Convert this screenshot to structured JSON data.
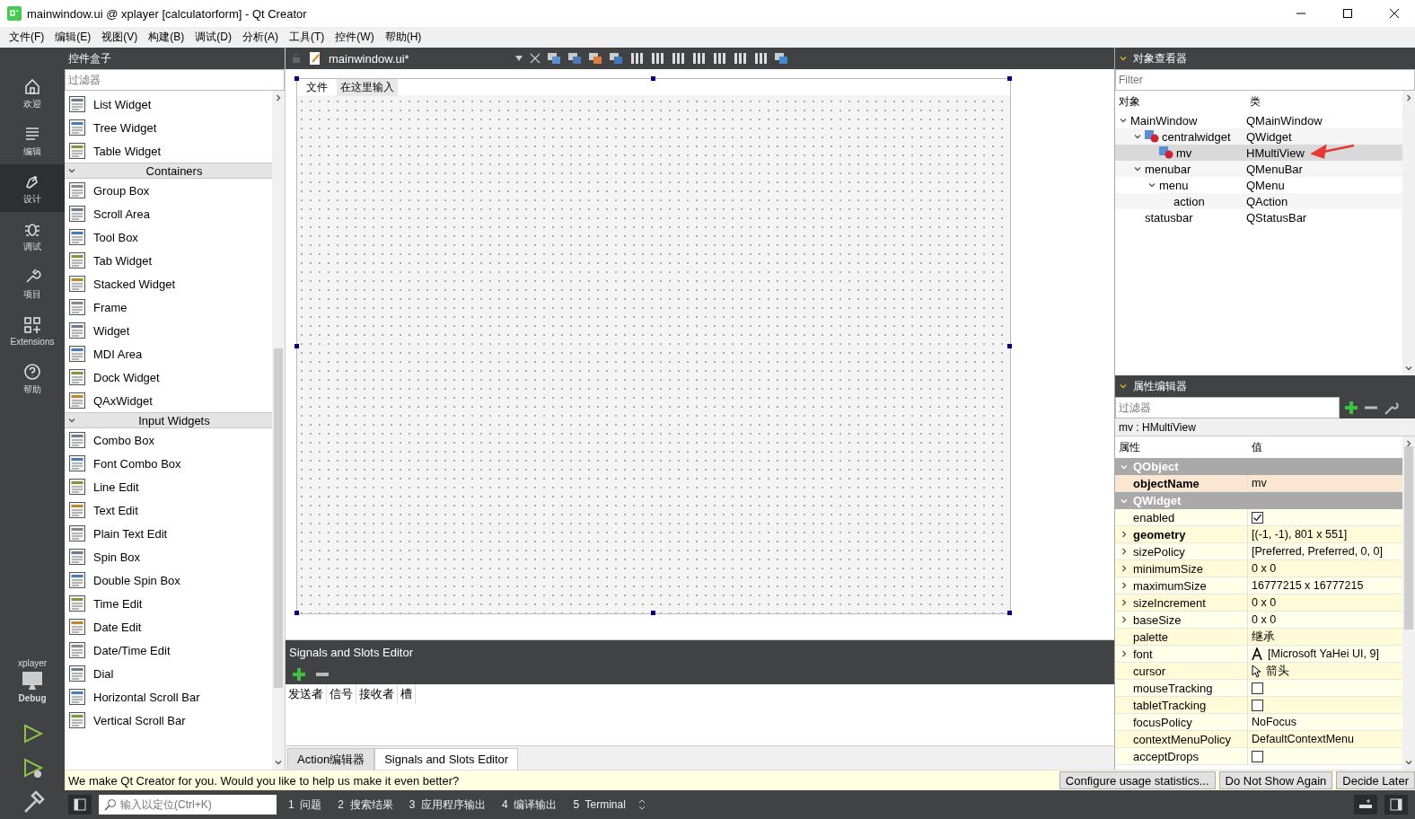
{
  "window": {
    "title": "mainwindow.ui @ xplayer [calculatorform] - Qt Creator"
  },
  "menu": [
    "文件(F)",
    "编辑(E)",
    "视图(V)",
    "构建(B)",
    "调试(D)",
    "分析(A)",
    "工具(T)",
    "控件(W)",
    "帮助(H)"
  ],
  "modes": [
    {
      "label": "欢迎",
      "selected": false
    },
    {
      "label": "编辑",
      "selected": false
    },
    {
      "label": "设计",
      "selected": true
    },
    {
      "label": "调试",
      "selected": false
    },
    {
      "label": "项目",
      "selected": false
    },
    {
      "label": "Extensions",
      "selected": false
    },
    {
      "label": "帮助",
      "selected": false
    }
  ],
  "target": {
    "project": "xplayer",
    "config": "Debug"
  },
  "toolbox": {
    "title": "控件盒子",
    "filter_placeholder": "过滤器",
    "items": [
      {
        "kind": "widget",
        "label": "List Widget"
      },
      {
        "kind": "widget",
        "label": "Tree Widget"
      },
      {
        "kind": "widget",
        "label": "Table Widget"
      },
      {
        "kind": "category",
        "label": "Containers",
        "expanded": true
      },
      {
        "kind": "widget",
        "label": "Group Box"
      },
      {
        "kind": "widget",
        "label": "Scroll Area"
      },
      {
        "kind": "widget",
        "label": "Tool Box"
      },
      {
        "kind": "widget",
        "label": "Tab Widget"
      },
      {
        "kind": "widget",
        "label": "Stacked Widget"
      },
      {
        "kind": "widget",
        "label": "Frame"
      },
      {
        "kind": "widget",
        "label": "Widget"
      },
      {
        "kind": "widget",
        "label": "MDI Area"
      },
      {
        "kind": "widget",
        "label": "Dock Widget"
      },
      {
        "kind": "widget",
        "label": "QAxWidget"
      },
      {
        "kind": "category",
        "label": "Input Widgets",
        "expanded": true
      },
      {
        "kind": "widget",
        "label": "Combo Box"
      },
      {
        "kind": "widget",
        "label": "Font Combo Box"
      },
      {
        "kind": "widget",
        "label": "Line Edit"
      },
      {
        "kind": "widget",
        "label": "Text Edit"
      },
      {
        "kind": "widget",
        "label": "Plain Text Edit"
      },
      {
        "kind": "widget",
        "label": "Spin Box"
      },
      {
        "kind": "widget",
        "label": "Double Spin Box"
      },
      {
        "kind": "widget",
        "label": "Time Edit"
      },
      {
        "kind": "widget",
        "label": "Date Edit"
      },
      {
        "kind": "widget",
        "label": "Date/Time Edit"
      },
      {
        "kind": "widget",
        "label": "Dial"
      },
      {
        "kind": "widget",
        "label": "Horizontal Scroll Bar"
      },
      {
        "kind": "widget",
        "label": "Vertical Scroll Bar"
      }
    ]
  },
  "editor": {
    "file": "mainwindow.ui*",
    "form_menu": [
      {
        "label": "文件",
        "kind": "menu"
      },
      {
        "label": "在这里输入",
        "kind": "placeholder"
      }
    ]
  },
  "signals_slots": {
    "title": "Signals and Slots Editor",
    "columns": [
      "发送者",
      "信号",
      "接收者",
      "槽"
    ]
  },
  "bottom_tabs": [
    {
      "label": "Action编辑器",
      "selected": false
    },
    {
      "label": "Signals and Slots Editor",
      "selected": true
    }
  ],
  "object_inspector": {
    "title": "对象查看器",
    "filter_placeholder": "Filter",
    "columns": [
      "对象",
      "类"
    ],
    "tree": [
      {
        "name": "MainWindow",
        "class": "QMainWindow",
        "expanded": true,
        "selected": false,
        "children": [
          {
            "name": "centralwidget",
            "class": "QWidget",
            "icon": true,
            "expanded": true,
            "selected": false,
            "children": [
              {
                "name": "mv",
                "class": "HMultiView",
                "icon": true,
                "selected": true
              }
            ]
          },
          {
            "name": "menubar",
            "class": "QMenuBar",
            "expanded": true,
            "selected": false,
            "children": [
              {
                "name": "menu",
                "class": "QMenu",
                "expanded": true,
                "selected": false,
                "children": [
                  {
                    "name": "action",
                    "class": "QAction",
                    "selected": false
                  }
                ]
              }
            ]
          },
          {
            "name": "statusbar",
            "class": "QStatusBar",
            "selected": false
          }
        ]
      }
    ]
  },
  "property_editor": {
    "title": "属性编辑器",
    "filter_placeholder": "过滤器",
    "object": "mv : HMultiView",
    "columns": [
      "属性",
      "值"
    ],
    "groups": [
      {
        "name": "QObject",
        "expanded": true,
        "properties": [
          {
            "name": "objectName",
            "kind": "text",
            "value": "mv",
            "bold": true,
            "expandable": false
          }
        ]
      },
      {
        "name": "QWidget",
        "expanded": true,
        "properties": [
          {
            "name": "enabled",
            "kind": "checkbox",
            "checked": true,
            "bold": false,
            "expandable": false
          },
          {
            "name": "geometry",
            "kind": "text",
            "value": "[(-1, -1), 801 x 551]",
            "bold": true,
            "expandable": true
          },
          {
            "name": "sizePolicy",
            "kind": "text",
            "value": "[Preferred, Preferred, 0, 0]",
            "bold": false,
            "expandable": true
          },
          {
            "name": "minimumSize",
            "kind": "text",
            "value": "0 x 0",
            "bold": false,
            "expandable": true
          },
          {
            "name": "maximumSize",
            "kind": "text",
            "value": "16777215 x 16777215",
            "bold": false,
            "expandable": true
          },
          {
            "name": "sizeIncrement",
            "kind": "text",
            "value": "0 x 0",
            "bold": false,
            "expandable": true
          },
          {
            "name": "baseSize",
            "kind": "text",
            "value": "0 x 0",
            "bold": false,
            "expandable": true
          },
          {
            "name": "palette",
            "kind": "text",
            "value": "继承",
            "bold": false,
            "expandable": false
          },
          {
            "name": "font",
            "kind": "font",
            "value": "[Microsoft YaHei UI, 9]",
            "bold": false,
            "expandable": true
          },
          {
            "name": "cursor",
            "kind": "cursor",
            "value": "箭头",
            "bold": false,
            "expandable": false
          },
          {
            "name": "mouseTracking",
            "kind": "checkbox",
            "checked": false,
            "bold": false,
            "expandable": false
          },
          {
            "name": "tabletTracking",
            "kind": "checkbox",
            "checked": false,
            "bold": false,
            "expandable": false
          },
          {
            "name": "focusPolicy",
            "kind": "text",
            "value": "NoFocus",
            "bold": false,
            "expandable": false
          },
          {
            "name": "contextMenuPolicy",
            "kind": "text",
            "value": "DefaultContextMenu",
            "bold": false,
            "expandable": false
          },
          {
            "name": "acceptDrops",
            "kind": "checkbox",
            "checked": false,
            "bold": false,
            "expandable": false
          }
        ]
      }
    ]
  },
  "info_bar": {
    "message": "We make Qt Creator for you. Would you like to help us make it even better?",
    "buttons": [
      "Configure usage statistics...",
      "Do Not Show Again",
      "Decide Later"
    ]
  },
  "status_bar": {
    "locator_placeholder": "输入以定位(Ctrl+K)",
    "panes": [
      "1  问题",
      "2  搜索结果",
      "3  应用程序输出",
      "4  编译输出",
      "5  Terminal"
    ]
  }
}
